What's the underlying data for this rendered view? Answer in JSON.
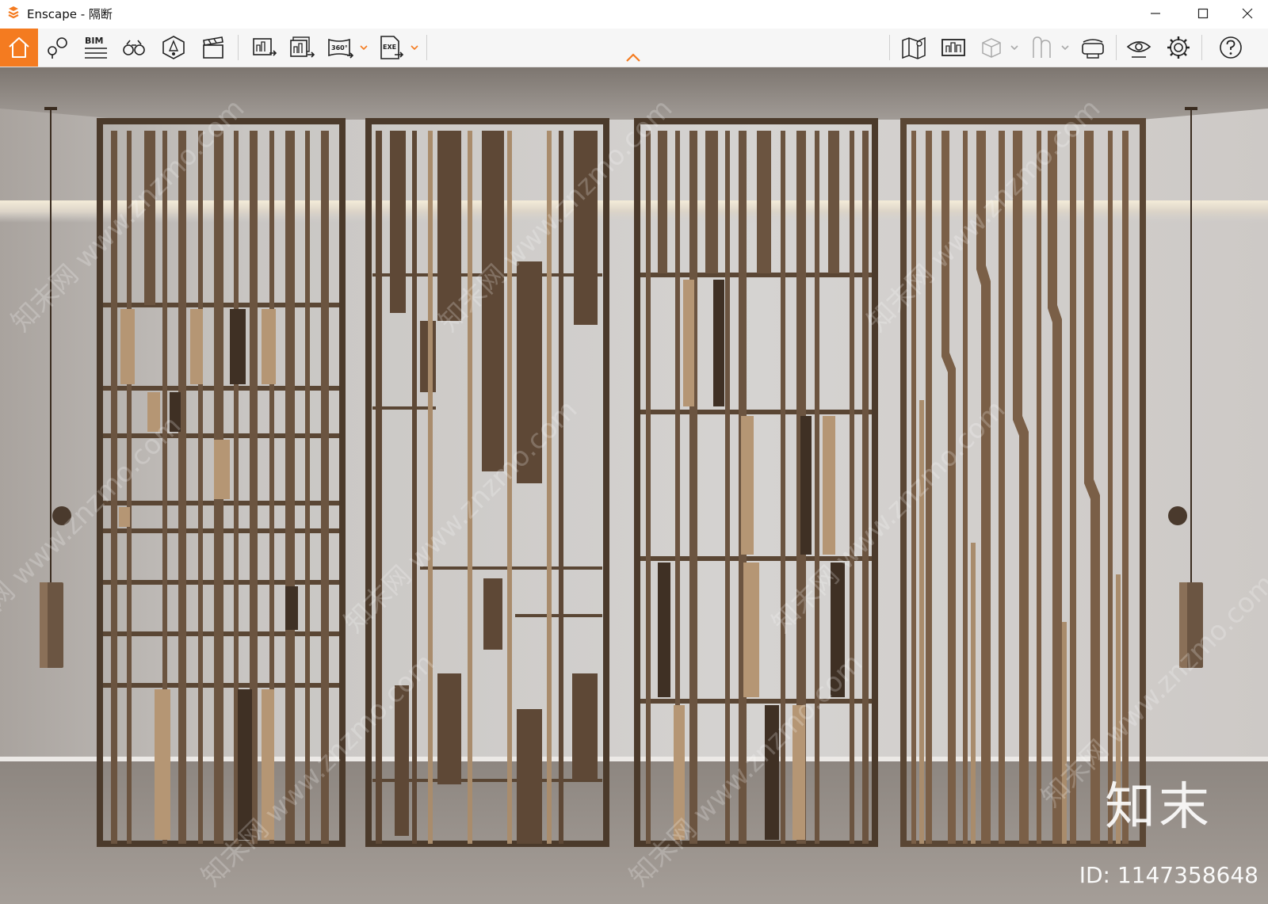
{
  "window": {
    "title": "Enscape - 隔断",
    "controls": [
      "minimize-icon",
      "maximize-icon",
      "close-icon"
    ]
  },
  "toolbar": {
    "accent_color": "#f47b20",
    "left_tools": [
      {
        "name": "home",
        "icon": "home-icon"
      },
      {
        "name": "views",
        "icon": "map-pin-icon"
      },
      {
        "name": "bim",
        "icon": "bim-icon",
        "label": "BIM"
      },
      {
        "name": "binoculars",
        "icon": "binoculars-icon"
      },
      {
        "name": "asset-library",
        "icon": "asset-library-icon"
      },
      {
        "name": "video-editor",
        "icon": "clapperboard-icon"
      },
      {
        "name": "render-image",
        "icon": "render-image-icon"
      },
      {
        "name": "batch-render",
        "icon": "batch-render-icon"
      },
      {
        "name": "panorama",
        "icon": "panorama-icon",
        "label": "360°"
      },
      {
        "name": "export-exe",
        "icon": "export-exe-icon",
        "label": "EXE"
      }
    ],
    "right_tools": [
      {
        "name": "map",
        "icon": "map-icon"
      },
      {
        "name": "screenshot-gallery",
        "icon": "gallery-icon"
      },
      {
        "name": "cube",
        "icon": "cube-icon"
      },
      {
        "name": "materials",
        "icon": "materials-icon"
      },
      {
        "name": "vr-headset",
        "icon": "vr-headset-icon"
      },
      {
        "name": "visual-settings",
        "icon": "eye-icon"
      },
      {
        "name": "settings",
        "icon": "gear-icon"
      },
      {
        "name": "help",
        "icon": "help-icon"
      }
    ]
  },
  "viewport": {
    "watermark_text": "知末网 www.znzmo.com",
    "brand_mark": "知末",
    "id_label": "ID: 1147358648"
  }
}
